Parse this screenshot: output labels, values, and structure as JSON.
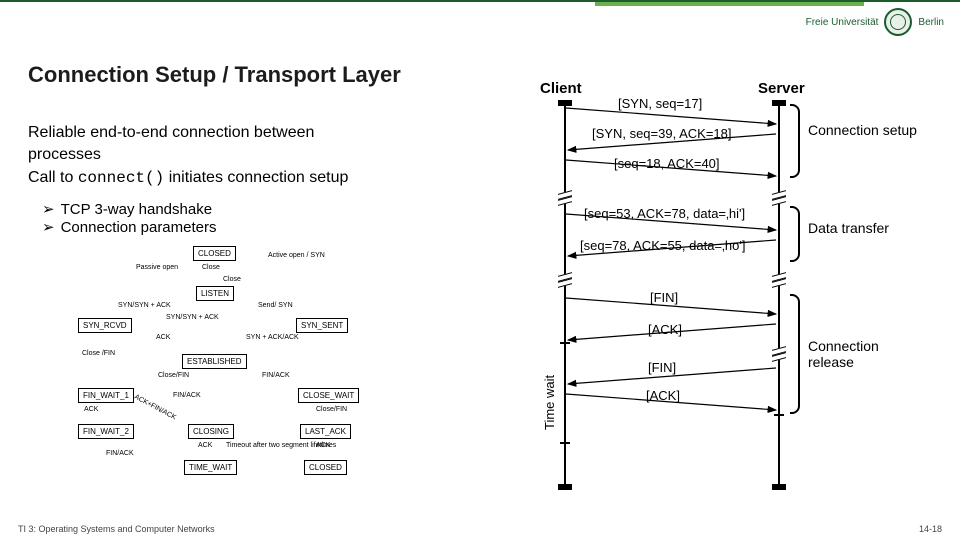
{
  "header": {
    "uni": "Freie Universität",
    "city": "Berlin"
  },
  "title": "Connection Setup / Transport Layer",
  "body": {
    "line1": "Reliable end-to-end connection between processes",
    "line2": "Call to",
    "code": "connect()",
    "line3": "initiates connection setup",
    "bullet1": "TCP 3-way handshake",
    "bullet2": "Connection parameters"
  },
  "statemachine": {
    "states": {
      "closed_top": "CLOSED",
      "listen": "LISTEN",
      "syn_rcvd": "SYN_RCVD",
      "syn_sent": "SYN_SENT",
      "established": "ESTABLISHED",
      "fin_wait_1": "FIN_WAIT_1",
      "fin_wait_2": "FIN_WAIT_2",
      "closing": "CLOSING",
      "time_wait": "TIME_WAIT",
      "close_wait": "CLOSE_WAIT",
      "last_ack": "LAST_ACK",
      "closed_bot": "CLOSED"
    },
    "labels": {
      "passive_open": "Passive open",
      "close": "Close",
      "close2": "Close",
      "active_open_syn": "Active open / SYN",
      "syn_synack": "SYN/SYN + ACK",
      "synsynack2": "SYN/SYN + ACK",
      "send_syn": "Send/ SYN",
      "ack": "ACK",
      "ack2": "ACK",
      "ack3": "ACK",
      "ack4": "ACK",
      "synack_ack": "SYN + ACK/ACK",
      "close_fin": "Close /FIN",
      "close_fin2": "Close/FIN",
      "close_fin3": "Close/FIN",
      "fin_ack": "FIN/ACK",
      "fin_ack2": "FIN/ACK",
      "fin_ack3": "FIN/ACK",
      "ack_finack": "ACK+FIN/ACK",
      "timeout": "Timeout after two segment lifetimes"
    }
  },
  "seq": {
    "client": "Client",
    "server": "Server",
    "msg1": "[SYN, seq=17]",
    "msg2": "[SYN, seq=39, ACK=18]",
    "msg3": "[seq=18, ACK=40]",
    "msg4": "[seq=53, ACK=78, data=‚hi']",
    "msg5": "[seq=78, ACK=55, data=‚ho']",
    "msg6": "[FIN]",
    "msg7": "[ACK]",
    "msg8": "[FIN]",
    "msg9": "[ACK]",
    "brace1": "Connection setup",
    "brace2": "Data transfer",
    "brace3": "Connection release",
    "timewait": "Time wait"
  },
  "footer": {
    "left": "TI 3: Operating Systems and Computer Networks",
    "right": "14-18"
  },
  "chart_data": {
    "type": "sequence-diagram",
    "participants": [
      "Client",
      "Server"
    ],
    "messages": [
      {
        "from": "Client",
        "to": "Server",
        "label": "[SYN, seq=17]",
        "phase": "Connection setup"
      },
      {
        "from": "Server",
        "to": "Client",
        "label": "[SYN, seq=39, ACK=18]",
        "phase": "Connection setup"
      },
      {
        "from": "Client",
        "to": "Server",
        "label": "[seq=18, ACK=40]",
        "phase": "Connection setup"
      },
      {
        "from": "Client",
        "to": "Server",
        "label": "[seq=53, ACK=78, data='hi']",
        "phase": "Data transfer"
      },
      {
        "from": "Server",
        "to": "Client",
        "label": "[seq=78, ACK=55, data='ho']",
        "phase": "Data transfer"
      },
      {
        "from": "Client",
        "to": "Server",
        "label": "[FIN]",
        "phase": "Connection release"
      },
      {
        "from": "Server",
        "to": "Client",
        "label": "[ACK]",
        "phase": "Connection release"
      },
      {
        "from": "Server",
        "to": "Client",
        "label": "[FIN]",
        "phase": "Connection release"
      },
      {
        "from": "Client",
        "to": "Server",
        "label": "[ACK]",
        "phase": "Connection release"
      }
    ],
    "tcp_state_machine_states": [
      "CLOSED",
      "LISTEN",
      "SYN_RCVD",
      "SYN_SENT",
      "ESTABLISHED",
      "FIN_WAIT_1",
      "FIN_WAIT_2",
      "CLOSING",
      "TIME_WAIT",
      "CLOSE_WAIT",
      "LAST_ACK",
      "CLOSED"
    ]
  }
}
